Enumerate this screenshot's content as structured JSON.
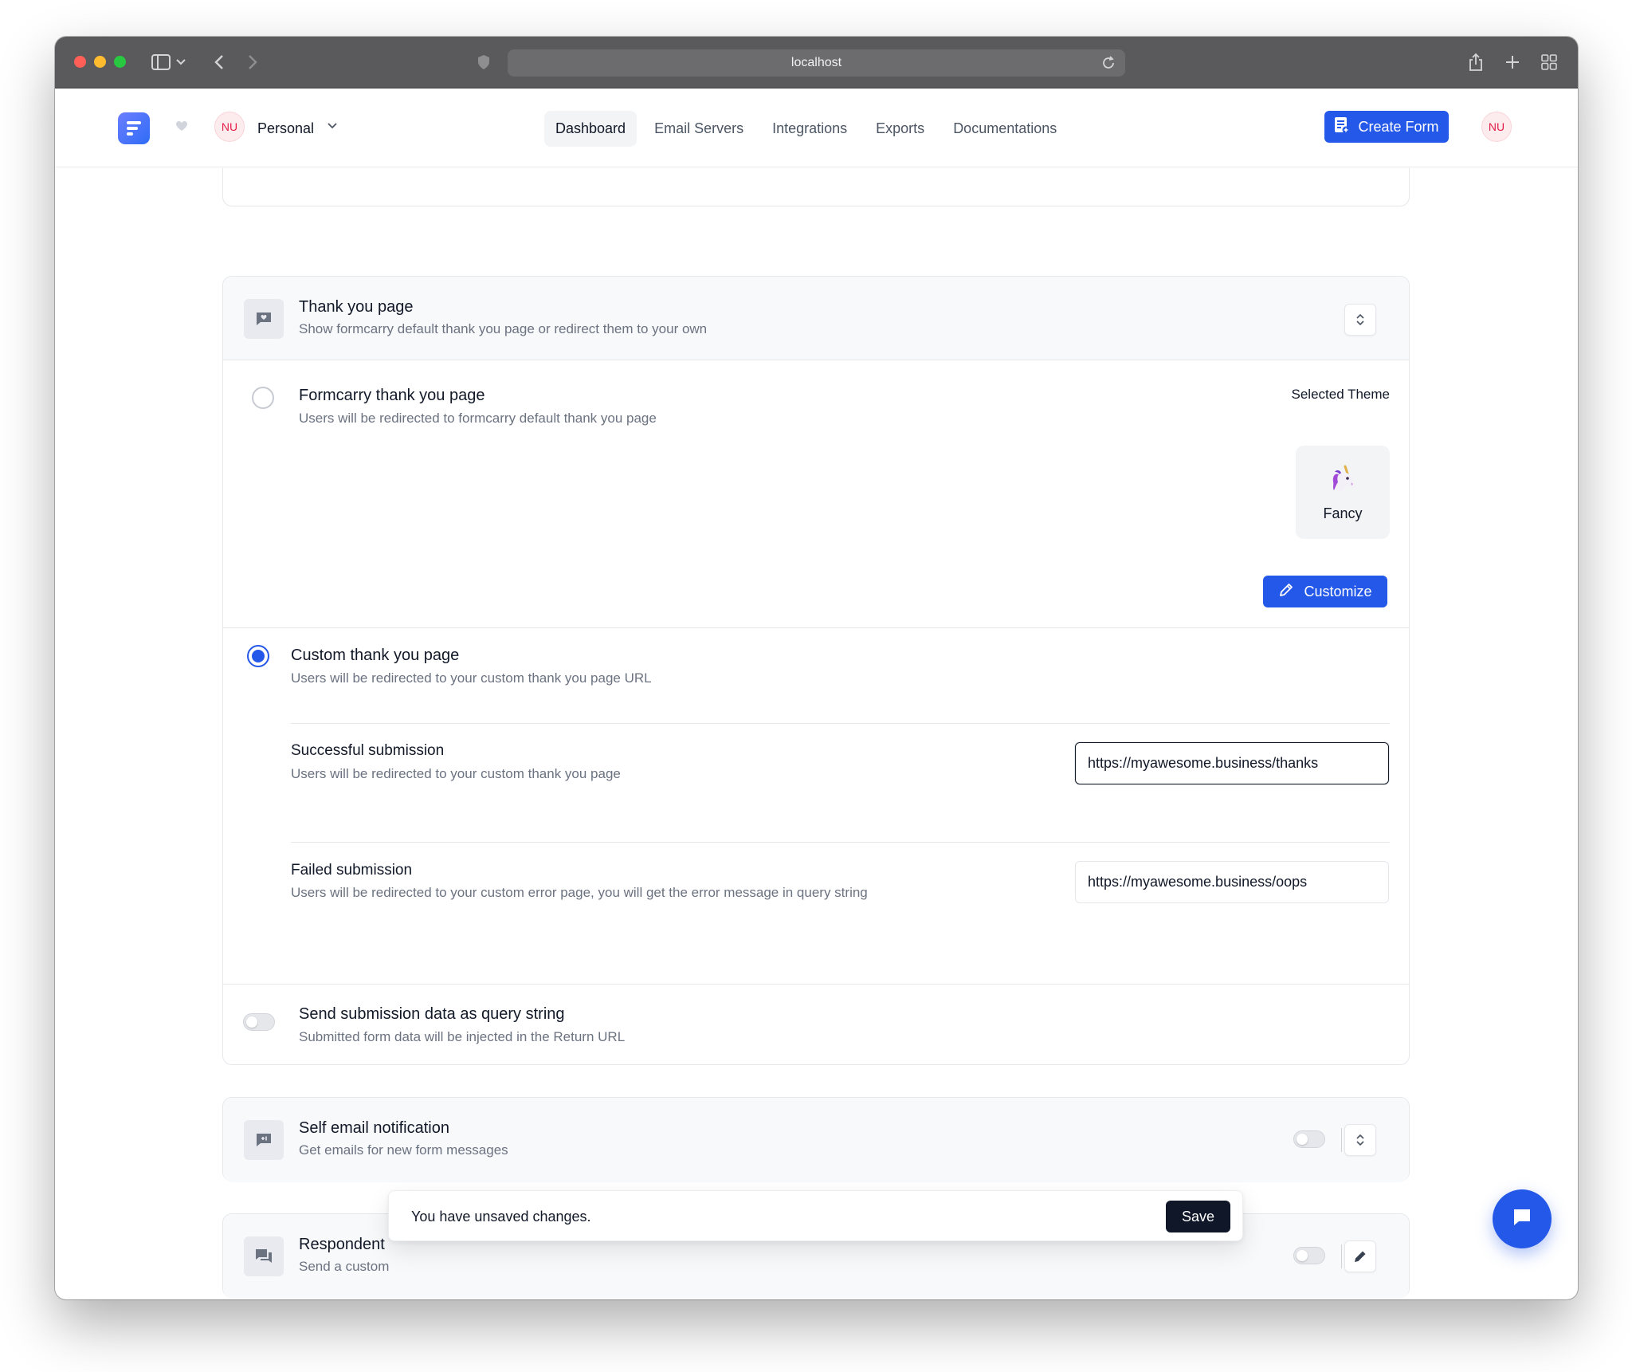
{
  "browser": {
    "url": "localhost"
  },
  "header": {
    "workspace_avatar": "NU",
    "workspace_name": "Personal",
    "nav": [
      {
        "label": "Dashboard",
        "active": true
      },
      {
        "label": "Email Servers",
        "active": false
      },
      {
        "label": "Integrations",
        "active": false
      },
      {
        "label": "Exports",
        "active": false
      },
      {
        "label": "Documentations",
        "active": false
      }
    ],
    "create_label": "Create Form",
    "user_avatar": "NU"
  },
  "thank_you": {
    "title": "Thank you page",
    "subtitle": "Show formcarry default thank you page or redirect them to your own",
    "default_option": {
      "title": "Formcarry thank you page",
      "subtitle": "Users will be redirected to formcarry default thank you page",
      "selected": false
    },
    "theme": {
      "label": "Selected Theme",
      "name": "Fancy",
      "icon": "unicorn-icon",
      "customize_label": "Customize"
    },
    "custom_option": {
      "title": "Custom thank you page",
      "subtitle": "Users will be redirected to your custom thank you page URL",
      "selected": true
    },
    "success": {
      "title": "Successful submission",
      "subtitle": "Users will be redirected to your custom thank you page",
      "value": "https://myawesome.business/thanks"
    },
    "failure": {
      "title": "Failed submission",
      "subtitle": "Users will be redirected to your custom error page, you will get the error message in query string",
      "value": "https://myawesome.business/oops"
    },
    "query_string": {
      "title": "Send submission data as query string",
      "subtitle": "Submitted form data will be injected in the Return URL",
      "enabled": false
    }
  },
  "self_email": {
    "title": "Self email notification",
    "subtitle": "Get emails for new form messages",
    "enabled": false
  },
  "respondent": {
    "title": "Respondent",
    "subtitle": "Send a custom",
    "enabled": false
  },
  "toast": {
    "message": "You have unsaved changes.",
    "save_label": "Save"
  },
  "colors": {
    "accent": "#2458e8",
    "toast_button": "#0f1729",
    "avatar_text": "#e11d48"
  }
}
